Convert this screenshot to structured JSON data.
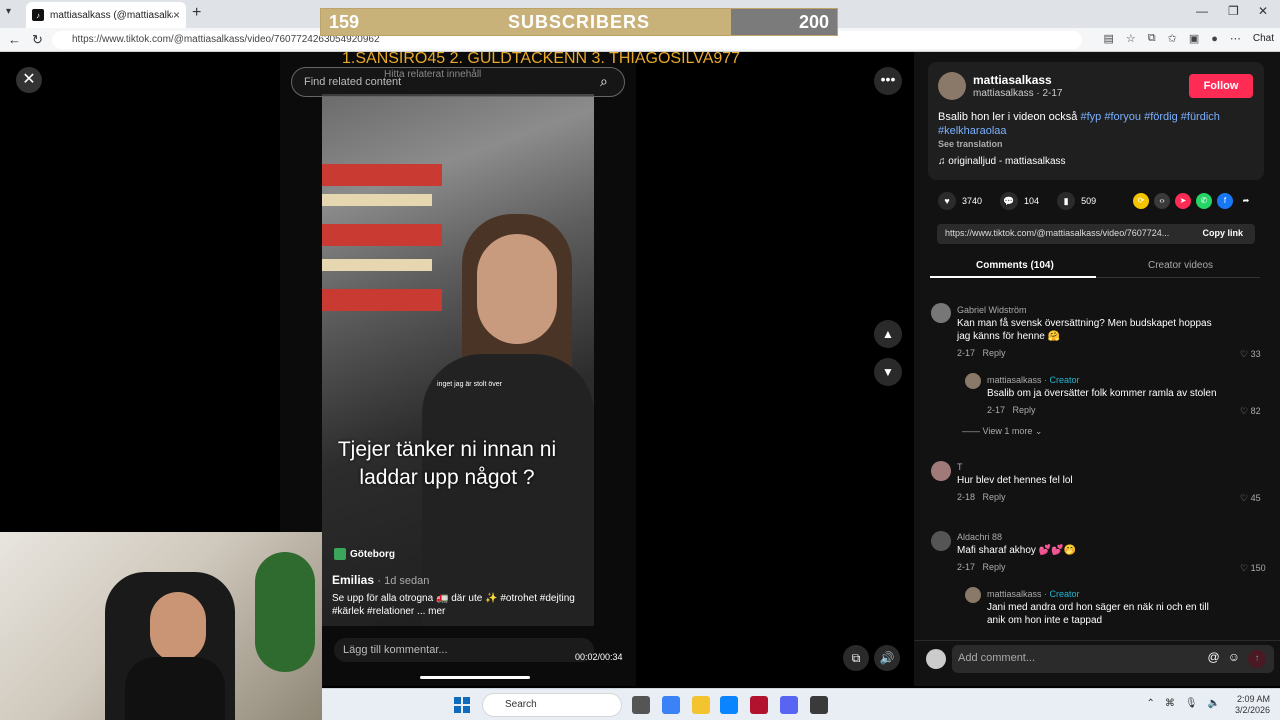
{
  "browser": {
    "tab_title": "mattiasalkass (@mattiasalkass)",
    "url": "https://www.tiktok.com/@mattiasalkass/video/7607724263054920962",
    "copilot_label": "Chat"
  },
  "overlay": {
    "subs_current": "159",
    "subs_label": "SUBSCRIBERS",
    "subs_goal": "200",
    "subs_progress": 0.795,
    "ticker": "1.SANSIRO45  2. GULDTACKENN 3. THIAGOSILVA977"
  },
  "video": {
    "search_placeholder": "Find related content",
    "search_overlay": "Hitta relaterat innehåll",
    "small_text": "inget jag är stolt över",
    "caption_line1": "Tjejer tänker ni innan ni",
    "caption_line2": "laddar upp något ?",
    "location": "Göteborg",
    "inner_user": "Emilias",
    "inner_time": "· 1d sedan",
    "inner_desc": "Se upp för alla otrogna 🚛 där ute ✨ #otrohet #dejting #kärlek #relationer ... mer",
    "inner_comment_placeholder": "Lägg till kommentar...",
    "time": "00:02/00:34"
  },
  "author": {
    "name": "mattiasalkass",
    "sub": "mattiasalkass · 2-17",
    "follow_label": "Follow",
    "caption": "Bsalib hon ler i videon också",
    "tags": "#fyp #foryou #fördig #fürdich #kelkharaolaa",
    "see_translation": "See translation",
    "music": "♫  originalljud - mattiasalkass"
  },
  "stats": {
    "likes": "3740",
    "comments": "104",
    "saves": "509"
  },
  "share": {
    "link_url": "https://www.tiktok.com/@mattiasalkass/video/7607724...",
    "copy_link": "Copy link"
  },
  "tabs": {
    "comments": "Comments (104)",
    "creator_videos": "Creator videos"
  },
  "comments": [
    {
      "name": "Gabriel Widström",
      "text": "Kan man få svensk översättning? Men budskapet hoppas jag känns för henne 🤗",
      "date": "2-17",
      "reply": "Reply",
      "likes": "33"
    },
    {
      "name": "mattiasalkass",
      "creator": "· Creator",
      "text": "Bsalib om ja översätter folk kommer ramla av stolen",
      "date": "2-17",
      "reply": "Reply",
      "likes": "82"
    },
    {
      "name": "T",
      "text": "Hur blev det hennes fel lol",
      "date": "2-18",
      "reply": "Reply",
      "likes": "45"
    },
    {
      "name": "Aldachri 88",
      "text": "Mafi sharaf akhoy 💕💕🤭",
      "date": "2-17",
      "reply": "Reply",
      "likes": "150"
    },
    {
      "name": "mattiasalkass",
      "creator": "· Creator",
      "text": "Jani med andra ord hon säger en näk ni och en till anik om hon inte e tappad"
    }
  ],
  "view_more": "View 1 more",
  "add_comment_placeholder": "Add comment...",
  "taskbar": {
    "search": "Search",
    "time": "2:09 AM",
    "date": "3/2/2026"
  }
}
